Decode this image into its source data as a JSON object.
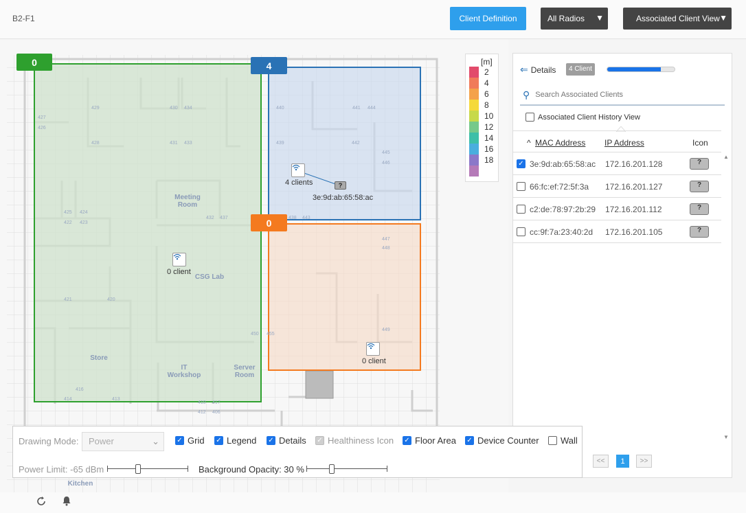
{
  "header": {
    "floor_name": "B2-F1",
    "client_definition_label": "Client Definition",
    "radios_label": "All Radios",
    "view_label": "Associated Client View"
  },
  "map": {
    "areas": [
      {
        "count": "0",
        "color": "#2ea02e"
      },
      {
        "count": "4",
        "color": "#2a72b5"
      },
      {
        "count": "0",
        "color": "#f47a1f"
      }
    ],
    "aps": [
      {
        "label": "0 client"
      },
      {
        "label": "4 clients"
      },
      {
        "label": "0 client"
      }
    ],
    "client_mac": "3e:9d:ab:65:58:ac",
    "rooms": {
      "meeting": "Meeting Room",
      "csg_lab": "CSG Lab",
      "store": "Store",
      "it_workshop": "IT Workshop",
      "server_room": "Server Room",
      "kitchen": "Kitchen"
    },
    "room_numbers": [
      "427",
      "426",
      "429",
      "430",
      "434",
      "428",
      "431",
      "433",
      "440",
      "441",
      "444",
      "439",
      "442",
      "445",
      "446",
      "425",
      "424",
      "422",
      "423",
      "432",
      "437",
      "438",
      "443",
      "447",
      "448",
      "421",
      "420",
      "450",
      "455",
      "449",
      "416",
      "414",
      "413",
      "412",
      "406",
      "410",
      "417"
    ]
  },
  "legend": {
    "unit": "[m]",
    "items": [
      {
        "value": "2",
        "color": "#e24b6b"
      },
      {
        "value": "4",
        "color": "#f07b5a"
      },
      {
        "value": "6",
        "color": "#f4a24a"
      },
      {
        "value": "8",
        "color": "#f5d93a"
      },
      {
        "value": "10",
        "color": "#c7d94a"
      },
      {
        "value": "12",
        "color": "#76c98a"
      },
      {
        "value": "14",
        "color": "#3dbfa8"
      },
      {
        "value": "16",
        "color": "#49aede"
      },
      {
        "value": "18",
        "color": "#8b78c9"
      },
      {
        "value": "",
        "color": "#b57ab8"
      }
    ]
  },
  "panel": {
    "details_label": "Details",
    "client_count": "4 Client",
    "progress": 0.8,
    "search_placeholder": "Search Associated Clients",
    "history_label": "Associated Client History View",
    "columns": {
      "mac": "MAC Address",
      "ip": "IP Address",
      "icon": "Icon"
    },
    "clients": [
      {
        "mac": "3e:9d:ab:65:58:ac",
        "ip": "172.16.201.128",
        "checked": true
      },
      {
        "mac": "66:fc:ef:72:5f:3a",
        "ip": "172.16.201.127",
        "checked": false
      },
      {
        "mac": "c2:de:78:97:2b:29",
        "ip": "172.16.201.112",
        "checked": false
      },
      {
        "mac": "cc:9f:7a:23:40:2d",
        "ip": "172.16.201.105",
        "checked": false
      }
    ],
    "pager": {
      "prev": "<<",
      "page": "1",
      "next": ">>"
    }
  },
  "toolbar": {
    "drawing_mode_label": "Drawing Mode:",
    "drawing_mode_value": "Power",
    "checkboxes": [
      {
        "label": "Grid",
        "checked": true
      },
      {
        "label": "Legend",
        "checked": true
      },
      {
        "label": "Details",
        "checked": true
      },
      {
        "label": "Healthiness Icon",
        "checked": true,
        "disabled": true
      },
      {
        "label": "Floor Area",
        "checked": true
      },
      {
        "label": "Device Counter",
        "checked": true
      },
      {
        "label": "Wall",
        "checked": false
      }
    ],
    "power_limit_label": "Power Limit: -65 dBm",
    "power_limit_level": 0.37,
    "opacity_label": "Background Opacity: 30 %",
    "opacity_level": 0.3
  },
  "footer": {
    "refresh_icon": "refresh-icon",
    "bell_icon": "bell-icon"
  }
}
